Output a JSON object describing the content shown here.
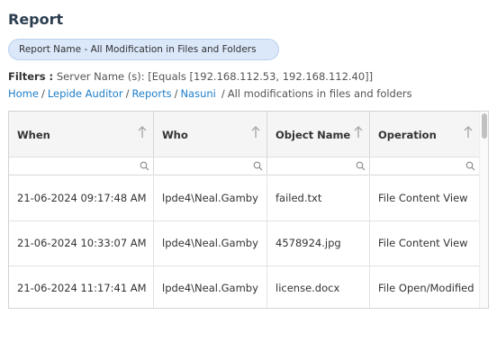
{
  "page": {
    "title": "Report",
    "report_name": "Report Name - All Modification in Files and Folders"
  },
  "filters": {
    "label": "Filters :",
    "text": "Server Name (s): [Equals [192.168.112.53, 192.168.112.40]]"
  },
  "breadcrumb": {
    "items": [
      "Home",
      "Lepide Auditor",
      "Reports",
      "Nasuni"
    ],
    "current": "All modifications in files and folders",
    "separator": "/"
  },
  "table": {
    "columns": [
      "When",
      "Who",
      "Object Name",
      "Operation"
    ],
    "rows": [
      [
        "21-06-2024 09:17:48 AM",
        "lpde4\\Neal.Gamby",
        "failed.txt",
        "File Content View"
      ],
      [
        "21-06-2024 10:33:07 AM",
        "lpde4\\Neal.Gamby",
        "4578924.jpg",
        "File Content View"
      ],
      [
        "21-06-2024 11:17:41 AM",
        "lpde4\\Neal.Gamby",
        "license.docx",
        "File Open/Modified"
      ]
    ]
  },
  "icons": {
    "sort": "sort-arrow-icon",
    "filter": "search-icon"
  },
  "colors": {
    "link": "#1f7ec9",
    "pill_bg": "#dbe8fa",
    "title": "#2c3e50"
  }
}
